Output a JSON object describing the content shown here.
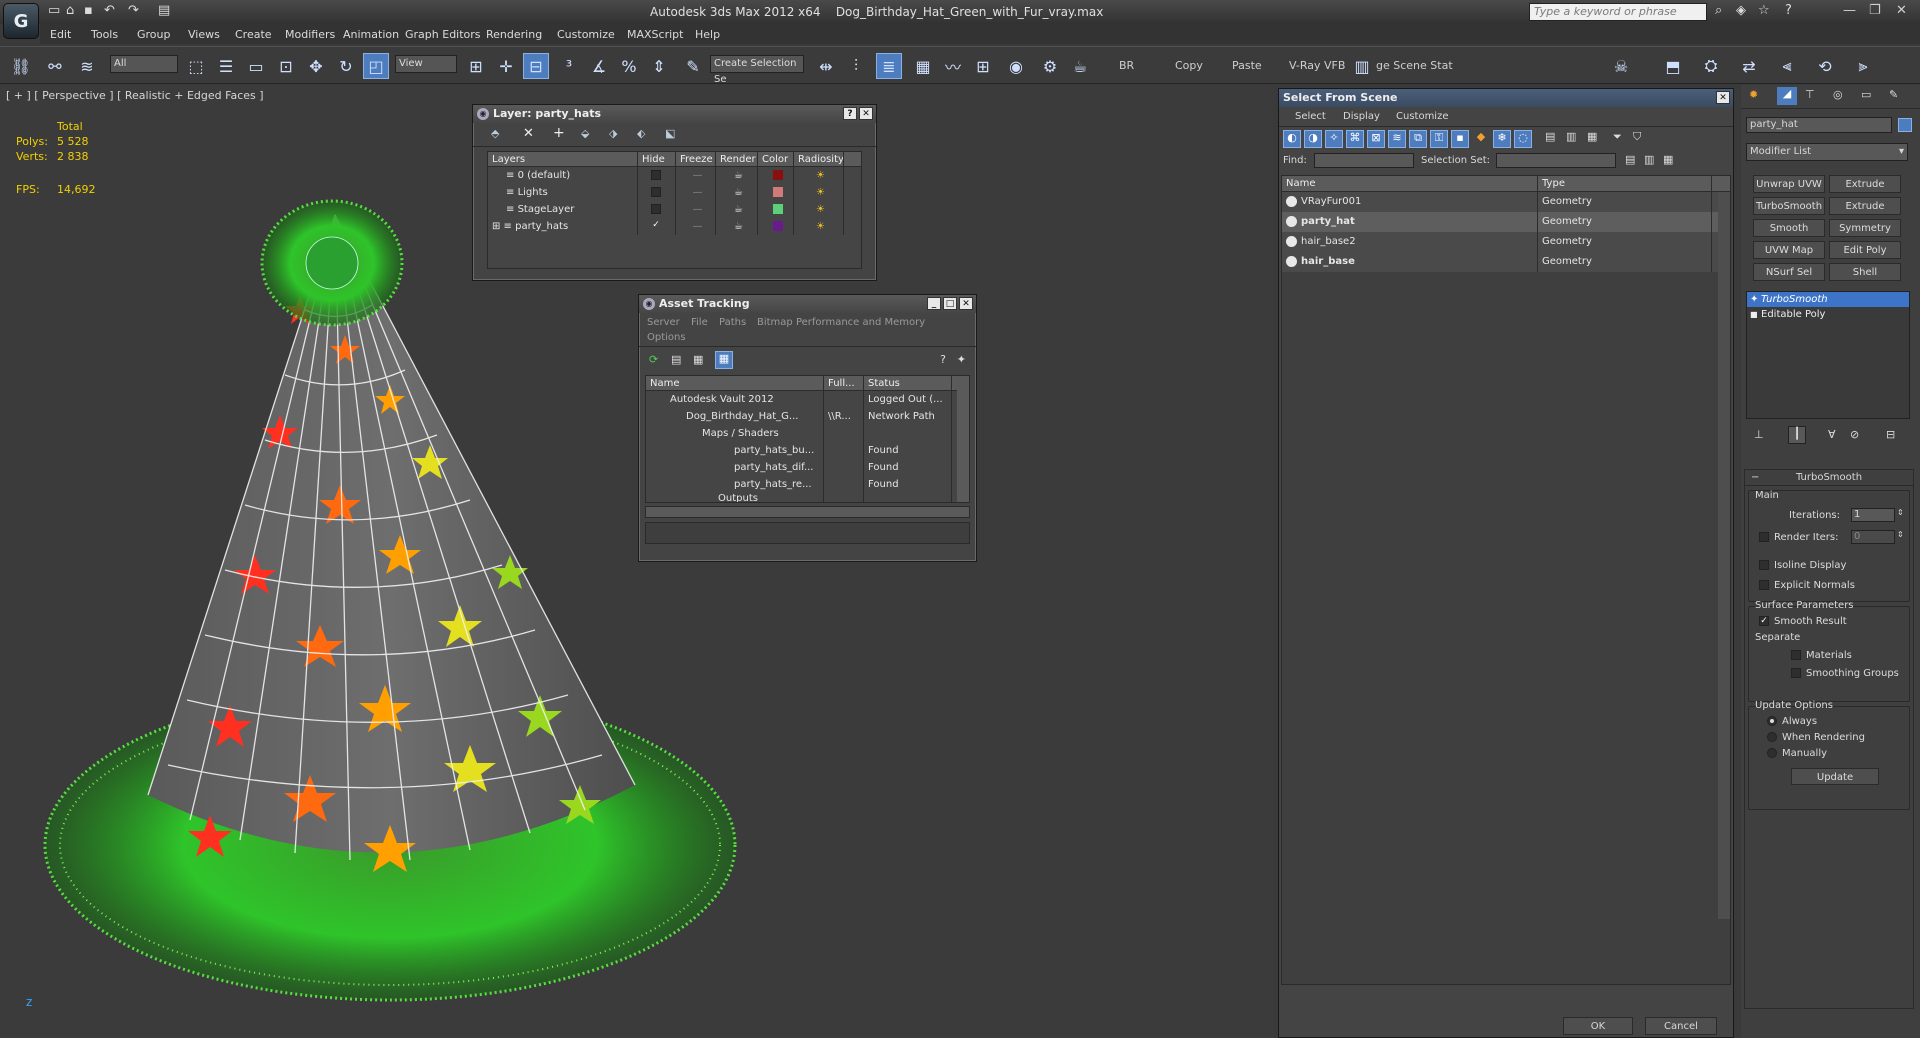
{
  "app": {
    "title": "Autodesk 3ds Max  2012 x64",
    "file": "Dog_Birthday_Hat_Green_with_Fur_vray.max",
    "logo": "3ds-max-logo",
    "search_placeholder": "Type a keyword or phrase"
  },
  "menus": [
    "Edit",
    "Tools",
    "Group",
    "Views",
    "Create",
    "Modifiers",
    "Animation",
    "Graph Editors",
    "Rendering",
    "Customize",
    "MAXScript",
    "Help"
  ],
  "toolbar": {
    "filter": "All",
    "ref_coord": "View",
    "selection_set": "Create Selection Se",
    "br": "BR",
    "copy": "Copy",
    "paste": "Paste",
    "vfb": "V-Ray VFB",
    "scene_stat": "ge Scene Stat"
  },
  "viewport": {
    "label": "[ + ] [ Perspective ] [ Realistic + Edged Faces ]",
    "stats": {
      "total": "Total",
      "polys_label": "Polys:",
      "polys": "5 528",
      "verts_label": "Verts:",
      "verts": "2 838",
      "fps_label": "FPS:",
      "fps": "14,692"
    }
  },
  "layer_window": {
    "title": "Layer: party_hats",
    "columns": [
      "Layers",
      "Hide",
      "Freeze",
      "Render",
      "Color",
      "Radiosity"
    ],
    "rows": [
      {
        "name": "0 (default)",
        "color": "#8a1010",
        "hide": ""
      },
      {
        "name": "Lights",
        "color": "#d07a7a",
        "hide": ""
      },
      {
        "name": "StageLayer",
        "color": "#5ccf7a",
        "hide": ""
      },
      {
        "name": "party_hats",
        "color": "#6a1a8a",
        "hide": "✓"
      }
    ]
  },
  "asset_window": {
    "title": "Asset Tracking",
    "menus": [
      "Server",
      "File",
      "Paths",
      "Bitmap Performance and Memory"
    ],
    "menu2": "Options",
    "columns": [
      "Name",
      "Full...",
      "Status"
    ],
    "rows": [
      {
        "name": "Autodesk Vault 2012",
        "full": "",
        "status": "Logged Out (..."
      },
      {
        "name": "Dog_Birthday_Hat_G...",
        "full": "\\\\R...",
        "status": "Network Path"
      },
      {
        "name": "Maps / Shaders",
        "full": "",
        "status": ""
      },
      {
        "name": "party_hats_bu...",
        "full": "",
        "status": "Found"
      },
      {
        "name": "party_hats_dif...",
        "full": "",
        "status": "Found"
      },
      {
        "name": "party_hats_re...",
        "full": "",
        "status": "Found"
      },
      {
        "name": "Outputs",
        "full": "",
        "status": ""
      }
    ]
  },
  "sfs": {
    "title": "Select From Scene",
    "menus": [
      "Select",
      "Display",
      "Customize"
    ],
    "find_label": "Find:",
    "selset_label": "Selection Set:",
    "columns": [
      "Name",
      "Type"
    ],
    "rows": [
      {
        "name": "VRayFur001",
        "type": "Geometry"
      },
      {
        "name": "party_hat",
        "type": "Geometry"
      },
      {
        "name": "hair_base2",
        "type": "Geometry"
      },
      {
        "name": "hair_base",
        "type": "Geometry"
      }
    ],
    "ok": "OK",
    "cancel": "Cancel"
  },
  "cmd_panel": {
    "object_name": "party_hat",
    "modifier_list": "Modifier List",
    "buttons": [
      "Unwrap UVW",
      "Extrude",
      "TurboSmooth",
      "Extrude",
      "Smooth",
      "Symmetry",
      "UVW Map",
      "Edit Poly",
      "NSurf Sel",
      "Shell"
    ],
    "stack": [
      "TurboSmooth",
      "Editable Poly"
    ],
    "rollout": {
      "title": "TurboSmooth",
      "main": "Main",
      "iterations_label": "Iterations:",
      "iterations": "1",
      "render_iters_label": "Render Iters:",
      "render_iters": "0",
      "isoline": "Isoline Display",
      "explicit": "Explicit Normals",
      "surface": "Surface Parameters",
      "smooth_result": "Smooth Result",
      "separate": "Separate",
      "materials": "Materials",
      "smoothing": "Smoothing Groups",
      "update_options": "Update Options",
      "always": "Always",
      "when_rendering": "When Rendering",
      "manually": "Manually",
      "update": "Update"
    }
  }
}
